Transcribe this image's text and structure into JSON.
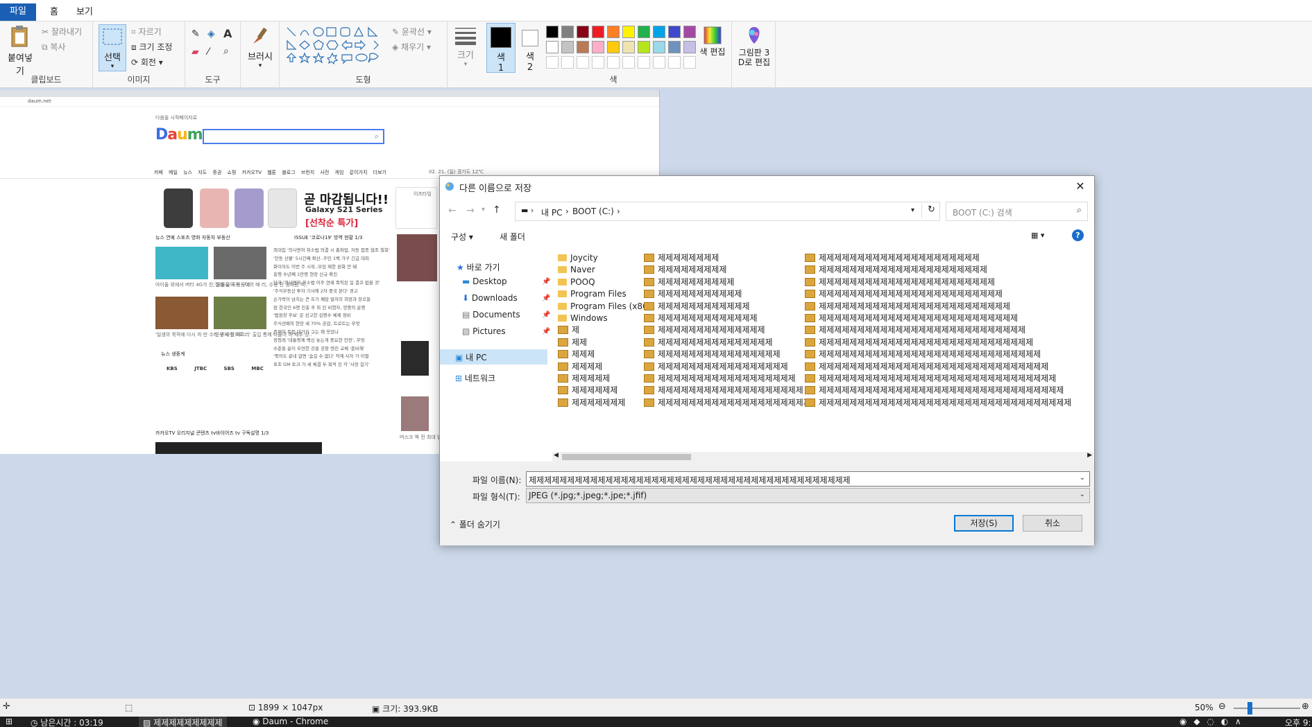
{
  "ribbon": {
    "tabs": [
      "파일",
      "홈",
      "보기"
    ],
    "clipboard": {
      "paste": "붙여넣기",
      "cut": "잘라내기",
      "copy": "복사",
      "label": "클립보드"
    },
    "image": {
      "select": "선택",
      "crop": "자르기",
      "resize": "크기 조정",
      "rotate": "회전",
      "label": "이미지"
    },
    "tools": {
      "label": "도구"
    },
    "brushes": {
      "label": "브러시"
    },
    "shapes": {
      "outline": "윤곽선",
      "fill": "채우기",
      "label": "도형"
    },
    "size": {
      "label": "크기"
    },
    "color1": {
      "label": "색",
      "num": "1"
    },
    "color2": {
      "label": "색",
      "num": "2"
    },
    "colors": {
      "label": "색",
      "edit": "색 편집",
      "palette": [
        "#000000",
        "#7f7f7f",
        "#880015",
        "#ed1c24",
        "#ff7f27",
        "#fff200",
        "#22b14c",
        "#00a2e8",
        "#3f48cc",
        "#a349a4",
        "#ffffff",
        "#c3c3c3",
        "#b97a57",
        "#ffaec9",
        "#ffc90e",
        "#efe4b0",
        "#b5e61d",
        "#99d9ea",
        "#7092be",
        "#c8bfe7"
      ]
    },
    "paint3d": {
      "line1": "그림판 3",
      "line2": "D로 편집"
    }
  },
  "web": {
    "address": "daum.net",
    "logo": "Daum",
    "top_note": "다음을 시작페이지로",
    "nav": "카페 메일 뉴스 지도 증권 쇼핑 카카오TV 웹툰 블로그 브런치 사전 게임 같이가치 더보기",
    "date": "02. 21. (일)  경기도  12℃",
    "ad_title": "곧 마감됩니다!!",
    "ad_sub": "Galaxy S21 Series",
    "ad_red": "[선착순 특가]",
    "news_tabs": "뉴스  연예  스포츠  영화  자동차  부동산",
    "issue": "ISSUE  '코로나19' 방역 현황   1/3",
    "news_lines": [
      "최대집 '의사면허 취소법 의결 시 총파업, 자동 접종 협조 철회'",
      "'안동 산불' 5시간째 확산..주민 1백 가구 긴급 대피",
      "화이자도 이번 주 시작..모임 제한 완화 안 돼",
      "흥행 수년째 1만명 현장 신규 확진",
      "당국 '의사면허 취소법 이후 연쇄 폭력된 일 결코 없을 것'",
      "",
      "'주식부동산 투자 기사에 2차 중국 본다' 경고",
      "손가락이 넘치는 큰 호가 폐암 발자의 희망과 장르들",
      "잠 한국인 6명 진출 후 외 진 비염자, 양중의 운명",
      "'법원장 후보' 문 선고한 김명수 체제 정비",
      "주식선배의 현장 세 70% 공감, 트로트는 무엇",
      "",
      "존재이 독립 대가지 그는 왜 웃었나",
      "정청래 '대통령께 백신 놓는게 중요한 안전', 무엇",
      "수준들 윤이 우연한 강릉 공항 엔진 교체 '준비해'",
      "'죽어도 끝내 알면 '숨길 수 없다' 적재 사자 가 이별",
      "표조 GM 토크 가 세 체결 두 목적 진 각 '사장 걸기'"
    ],
    "left_caps": [
      "아이들 위에서 버터 4G가 친, 토물로 국적 구조",
      "'집에 물이 동동이어 매 리, 수상 잔 경비원 칙..'",
      "'일생의 목적에 다시 까 만 수리 구제 앞으로..'",
      "'인생 사진 찍으러' 출입 통제 나들이 하 제주 상..'"
    ],
    "tv_label": "뉴스 생중계",
    "tv_channels": [
      "KBS",
      "JTBC",
      "SBS",
      "MBC"
    ],
    "tv_strip": "카카오TV  오리지널 콘텐츠   tv바이어즈   tv 구독설명   1/3",
    "side_top": "이츠타임",
    "side_caps": [
      "머스크 엑 전 최대 발 GELEIS 나"
    ]
  },
  "dialog": {
    "title": "다른 이름으로 저장",
    "close": "✕",
    "breadcrumbs": [
      "내 PC",
      "BOOT (C:)"
    ],
    "search_placeholder": "BOOT (C:) 검색",
    "organize": "구성 ▾",
    "new_folder": "새 폴더",
    "nav": {
      "quick": "바로 가기",
      "desktop": "Desktop",
      "downloads": "Downloads",
      "documents": "Documents",
      "pictures": "Pictures",
      "pc": "내 PC",
      "network": "네트워크"
    },
    "col1": [
      {
        "name": "Joycity",
        "type": "folder"
      },
      {
        "name": "Naver",
        "type": "folder"
      },
      {
        "name": "POOQ",
        "type": "folder"
      },
      {
        "name": "Program Files",
        "type": "folder"
      },
      {
        "name": "Program Files (x86)",
        "type": "folder"
      },
      {
        "name": "Windows",
        "type": "folder"
      },
      {
        "name": "제",
        "type": "jpg"
      },
      {
        "name": "제제",
        "type": "jpg"
      },
      {
        "name": "제제제",
        "type": "jpg"
      },
      {
        "name": "제제제제",
        "type": "jpg"
      },
      {
        "name": "제제제제제",
        "type": "jpg"
      },
      {
        "name": "제제제제제제",
        "type": "jpg"
      },
      {
        "name": "제제제제제제제",
        "type": "jpg"
      }
    ],
    "col2": [
      {
        "name": "제제제제제제제제",
        "type": "jpg"
      },
      {
        "name": "제제제제제제제제제",
        "type": "jpg"
      },
      {
        "name": "제제제제제제제제제제",
        "type": "jpg"
      },
      {
        "name": "제제제제제제제제제제제",
        "type": "jpg"
      },
      {
        "name": "제제제제제제제제제제제제",
        "type": "jpg"
      },
      {
        "name": "제제제제제제제제제제제제제",
        "type": "jpg"
      },
      {
        "name": "제제제제제제제제제제제제제제",
        "type": "jpg"
      },
      {
        "name": "제제제제제제제제제제제제제제제",
        "type": "jpg"
      },
      {
        "name": "제제제제제제제제제제제제제제제제",
        "type": "jpg"
      },
      {
        "name": "제제제제제제제제제제제제제제제제제",
        "type": "jpg"
      },
      {
        "name": "제제제제제제제제제제제제제제제제제제",
        "type": "jpg"
      },
      {
        "name": "제제제제제제제제제제제제제제제제제제제",
        "type": "jpg"
      },
      {
        "name": "제제제제제제제제제제제제제제제제제제제제",
        "type": "jpg"
      }
    ],
    "col3": [
      {
        "name": "제제제제제제제제제제제제제제제제제제제제제",
        "type": "jpg"
      },
      {
        "name": "제제제제제제제제제제제제제제제제제제제제제제",
        "type": "jpg"
      },
      {
        "name": "제제제제제제제제제제제제제제제제제제제제제제제",
        "type": "jpg"
      },
      {
        "name": "제제제제제제제제제제제제제제제제제제제제제제제제",
        "type": "jpg"
      },
      {
        "name": "제제제제제제제제제제제제제제제제제제제제제제제제제",
        "type": "jpg"
      },
      {
        "name": "제제제제제제제제제제제제제제제제제제제제제제제제제제",
        "type": "jpg"
      },
      {
        "name": "제제제제제제제제제제제제제제제제제제제제제제제제제제제",
        "type": "jpg"
      },
      {
        "name": "제제제제제제제제제제제제제제제제제제제제제제제제제제제제",
        "type": "jpg"
      },
      {
        "name": "제제제제제제제제제제제제제제제제제제제제제제제제제제제제제",
        "type": "jpg"
      },
      {
        "name": "제제제제제제제제제제제제제제제제제제제제제제제제제제제제제제",
        "type": "jpg"
      },
      {
        "name": "제제제제제제제제제제제제제제제제제제제제제제제제제제제제제제제",
        "type": "jpg"
      },
      {
        "name": "제제제제제제제제제제제제제제제제제제제제제제제제제제제제제제제제",
        "type": "jpg"
      },
      {
        "name": "제제제제제제제제제제제제제제제제제제제제제제제제제제제제제제제제제",
        "type": "jpg"
      }
    ],
    "filename_label": "파일 이름(N):",
    "filename_value": "제제제제제제제제제제제제제제제제제제제제제제제제제제제제제제제제제제제제제제제제제제",
    "filetype_label": "파일 형식(T):",
    "filetype_value": "JPEG (*.jpg;*.jpeg;*.jpe;*.jfif)",
    "hide_folders": "폴더 숨기기",
    "save": "저장(S)",
    "cancel": "취소"
  },
  "status": {
    "dimensions": "1899 × 1047px",
    "size": "크기: 393.9KB",
    "zoom": "50%"
  },
  "taskbar": {
    "timer": "남은시간 : 03:19",
    "app1": "제제제제제제제제제",
    "app2": "Daum - Chrome",
    "clock": "오후 9:"
  }
}
